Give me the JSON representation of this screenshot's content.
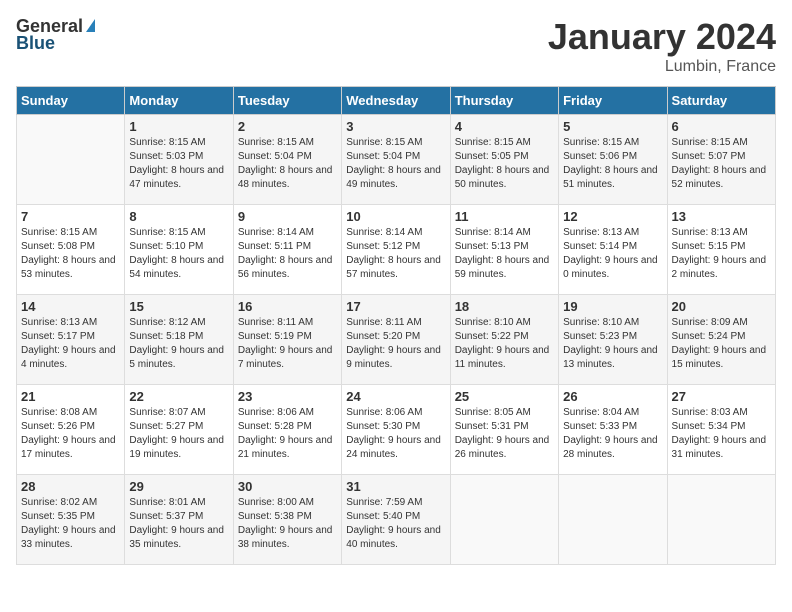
{
  "header": {
    "logo_general": "General",
    "logo_blue": "Blue",
    "month_title": "January 2024",
    "location": "Lumbin, France"
  },
  "weekdays": [
    "Sunday",
    "Monday",
    "Tuesday",
    "Wednesday",
    "Thursday",
    "Friday",
    "Saturday"
  ],
  "weeks": [
    [
      {
        "day": "",
        "sunrise": "",
        "sunset": "",
        "daylight": ""
      },
      {
        "day": "1",
        "sunrise": "Sunrise: 8:15 AM",
        "sunset": "Sunset: 5:03 PM",
        "daylight": "Daylight: 8 hours and 47 minutes."
      },
      {
        "day": "2",
        "sunrise": "Sunrise: 8:15 AM",
        "sunset": "Sunset: 5:04 PM",
        "daylight": "Daylight: 8 hours and 48 minutes."
      },
      {
        "day": "3",
        "sunrise": "Sunrise: 8:15 AM",
        "sunset": "Sunset: 5:04 PM",
        "daylight": "Daylight: 8 hours and 49 minutes."
      },
      {
        "day": "4",
        "sunrise": "Sunrise: 8:15 AM",
        "sunset": "Sunset: 5:05 PM",
        "daylight": "Daylight: 8 hours and 50 minutes."
      },
      {
        "day": "5",
        "sunrise": "Sunrise: 8:15 AM",
        "sunset": "Sunset: 5:06 PM",
        "daylight": "Daylight: 8 hours and 51 minutes."
      },
      {
        "day": "6",
        "sunrise": "Sunrise: 8:15 AM",
        "sunset": "Sunset: 5:07 PM",
        "daylight": "Daylight: 8 hours and 52 minutes."
      }
    ],
    [
      {
        "day": "7",
        "sunrise": "Sunrise: 8:15 AM",
        "sunset": "Sunset: 5:08 PM",
        "daylight": "Daylight: 8 hours and 53 minutes."
      },
      {
        "day": "8",
        "sunrise": "Sunrise: 8:15 AM",
        "sunset": "Sunset: 5:10 PM",
        "daylight": "Daylight: 8 hours and 54 minutes."
      },
      {
        "day": "9",
        "sunrise": "Sunrise: 8:14 AM",
        "sunset": "Sunset: 5:11 PM",
        "daylight": "Daylight: 8 hours and 56 minutes."
      },
      {
        "day": "10",
        "sunrise": "Sunrise: 8:14 AM",
        "sunset": "Sunset: 5:12 PM",
        "daylight": "Daylight: 8 hours and 57 minutes."
      },
      {
        "day": "11",
        "sunrise": "Sunrise: 8:14 AM",
        "sunset": "Sunset: 5:13 PM",
        "daylight": "Daylight: 8 hours and 59 minutes."
      },
      {
        "day": "12",
        "sunrise": "Sunrise: 8:13 AM",
        "sunset": "Sunset: 5:14 PM",
        "daylight": "Daylight: 9 hours and 0 minutes."
      },
      {
        "day": "13",
        "sunrise": "Sunrise: 8:13 AM",
        "sunset": "Sunset: 5:15 PM",
        "daylight": "Daylight: 9 hours and 2 minutes."
      }
    ],
    [
      {
        "day": "14",
        "sunrise": "Sunrise: 8:13 AM",
        "sunset": "Sunset: 5:17 PM",
        "daylight": "Daylight: 9 hours and 4 minutes."
      },
      {
        "day": "15",
        "sunrise": "Sunrise: 8:12 AM",
        "sunset": "Sunset: 5:18 PM",
        "daylight": "Daylight: 9 hours and 5 minutes."
      },
      {
        "day": "16",
        "sunrise": "Sunrise: 8:11 AM",
        "sunset": "Sunset: 5:19 PM",
        "daylight": "Daylight: 9 hours and 7 minutes."
      },
      {
        "day": "17",
        "sunrise": "Sunrise: 8:11 AM",
        "sunset": "Sunset: 5:20 PM",
        "daylight": "Daylight: 9 hours and 9 minutes."
      },
      {
        "day": "18",
        "sunrise": "Sunrise: 8:10 AM",
        "sunset": "Sunset: 5:22 PM",
        "daylight": "Daylight: 9 hours and 11 minutes."
      },
      {
        "day": "19",
        "sunrise": "Sunrise: 8:10 AM",
        "sunset": "Sunset: 5:23 PM",
        "daylight": "Daylight: 9 hours and 13 minutes."
      },
      {
        "day": "20",
        "sunrise": "Sunrise: 8:09 AM",
        "sunset": "Sunset: 5:24 PM",
        "daylight": "Daylight: 9 hours and 15 minutes."
      }
    ],
    [
      {
        "day": "21",
        "sunrise": "Sunrise: 8:08 AM",
        "sunset": "Sunset: 5:26 PM",
        "daylight": "Daylight: 9 hours and 17 minutes."
      },
      {
        "day": "22",
        "sunrise": "Sunrise: 8:07 AM",
        "sunset": "Sunset: 5:27 PM",
        "daylight": "Daylight: 9 hours and 19 minutes."
      },
      {
        "day": "23",
        "sunrise": "Sunrise: 8:06 AM",
        "sunset": "Sunset: 5:28 PM",
        "daylight": "Daylight: 9 hours and 21 minutes."
      },
      {
        "day": "24",
        "sunrise": "Sunrise: 8:06 AM",
        "sunset": "Sunset: 5:30 PM",
        "daylight": "Daylight: 9 hours and 24 minutes."
      },
      {
        "day": "25",
        "sunrise": "Sunrise: 8:05 AM",
        "sunset": "Sunset: 5:31 PM",
        "daylight": "Daylight: 9 hours and 26 minutes."
      },
      {
        "day": "26",
        "sunrise": "Sunrise: 8:04 AM",
        "sunset": "Sunset: 5:33 PM",
        "daylight": "Daylight: 9 hours and 28 minutes."
      },
      {
        "day": "27",
        "sunrise": "Sunrise: 8:03 AM",
        "sunset": "Sunset: 5:34 PM",
        "daylight": "Daylight: 9 hours and 31 minutes."
      }
    ],
    [
      {
        "day": "28",
        "sunrise": "Sunrise: 8:02 AM",
        "sunset": "Sunset: 5:35 PM",
        "daylight": "Daylight: 9 hours and 33 minutes."
      },
      {
        "day": "29",
        "sunrise": "Sunrise: 8:01 AM",
        "sunset": "Sunset: 5:37 PM",
        "daylight": "Daylight: 9 hours and 35 minutes."
      },
      {
        "day": "30",
        "sunrise": "Sunrise: 8:00 AM",
        "sunset": "Sunset: 5:38 PM",
        "daylight": "Daylight: 9 hours and 38 minutes."
      },
      {
        "day": "31",
        "sunrise": "Sunrise: 7:59 AM",
        "sunset": "Sunset: 5:40 PM",
        "daylight": "Daylight: 9 hours and 40 minutes."
      },
      {
        "day": "",
        "sunrise": "",
        "sunset": "",
        "daylight": ""
      },
      {
        "day": "",
        "sunrise": "",
        "sunset": "",
        "daylight": ""
      },
      {
        "day": "",
        "sunrise": "",
        "sunset": "",
        "daylight": ""
      }
    ]
  ]
}
